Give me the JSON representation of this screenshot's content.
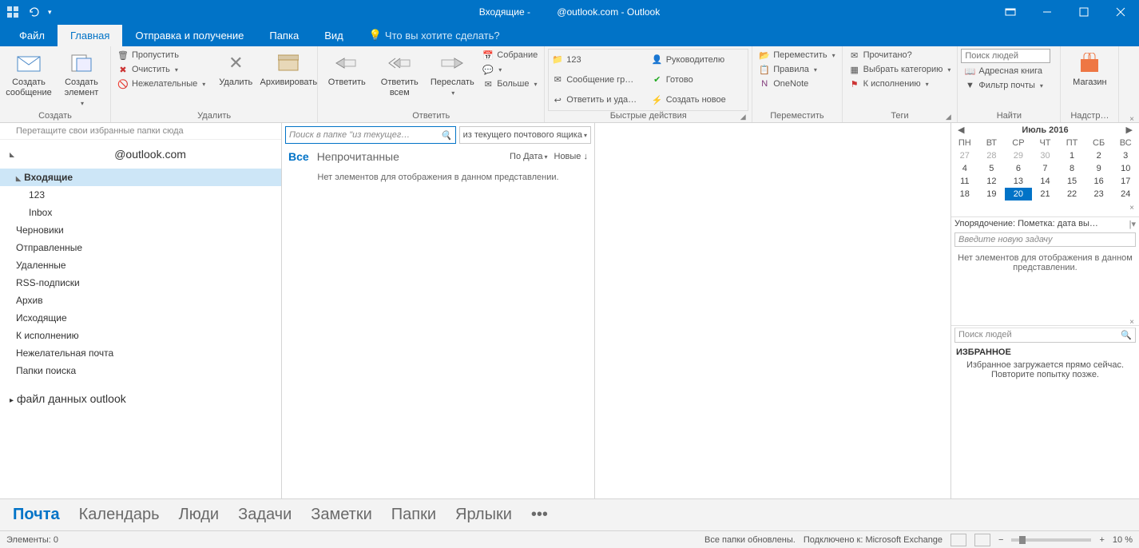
{
  "titlebar": {
    "title_left": "Входящие -",
    "title_right": "@outlook.com - Outlook"
  },
  "tabs": {
    "file": "Файл",
    "home": "Главная",
    "sendreceive": "Отправка и получение",
    "folder": "Папка",
    "view": "Вид",
    "tellme": "Что вы хотите сделать?"
  },
  "ribbon": {
    "new": {
      "msg": "Создать сообщение",
      "item": "Создать элемент",
      "label": "Создать"
    },
    "delete": {
      "ignore": "Пропустить",
      "clean": "Очистить",
      "junk": "Нежелательные",
      "delete": "Удалить",
      "archive": "Архивировать",
      "label": "Удалить"
    },
    "respond": {
      "reply": "Ответить",
      "replyall": "Ответить всем",
      "forward": "Переслать",
      "meeting": "Собрание",
      "more": "Больше",
      "label": "Ответить"
    },
    "quick": {
      "c1": "123",
      "c2": "Сообщение гр…",
      "c3": "Ответить и уда…",
      "c4": "Руководителю",
      "c5": "Готово",
      "c6": "Создать новое",
      "label": "Быстрые действия"
    },
    "move": {
      "move": "Переместить",
      "rules": "Правила",
      "onenote": "OneNote",
      "label": "Переместить"
    },
    "tags": {
      "unread": "Прочитано?",
      "categorize": "Выбрать категорию",
      "followup": "К исполнению",
      "label": "Теги"
    },
    "find": {
      "search_ph": "Поиск людей",
      "addrbook": "Адресная книга",
      "filter": "Фильтр почты",
      "label": "Найти"
    },
    "store": {
      "label_btn": "Магазин",
      "label": "Надстр…"
    }
  },
  "folders": {
    "hint": "Перетащите свои избранные папки сюда",
    "account": "@outlook.com",
    "items": [
      {
        "name": "Входящие",
        "sel": true,
        "exp": true
      },
      {
        "name": "123",
        "sub": true
      },
      {
        "name": "Inbox",
        "sub": true
      },
      {
        "name": "Черновики"
      },
      {
        "name": "Отправленные"
      },
      {
        "name": "Удаленные"
      },
      {
        "name": "RSS-подписки"
      },
      {
        "name": "Архив"
      },
      {
        "name": "Исходящие"
      },
      {
        "name": "К исполнению"
      },
      {
        "name": "Нежелательная почта"
      },
      {
        "name": "Папки поиска"
      }
    ],
    "datafile": "файл данных outlook"
  },
  "msglist": {
    "search_ph": "Поиск в папке \"из текущег…",
    "scope": "из текущего почтового ящика",
    "filter_all": "Все",
    "filter_unread": "Непрочитанные",
    "sort_by": "По Дата",
    "sort_dir": "Новые ↓",
    "empty": "Нет элементов для отображения в данном представлении."
  },
  "todo": {
    "month": "Июль 2016",
    "dow": [
      "ПН",
      "ВТ",
      "СР",
      "ЧТ",
      "ПТ",
      "СБ",
      "ВС"
    ],
    "weeks": [
      [
        "27",
        "28",
        "29",
        "30",
        "1",
        "2",
        "3"
      ],
      [
        "4",
        "5",
        "6",
        "7",
        "8",
        "9",
        "10"
      ],
      [
        "11",
        "12",
        "13",
        "14",
        "15",
        "16",
        "17"
      ],
      [
        "18",
        "19",
        "20",
        "21",
        "22",
        "23",
        "24"
      ]
    ],
    "today": "20",
    "task_sort": "Упорядочение: Пометка: дата вы…",
    "task_ph": "Введите новую задачу",
    "no_items": "Нет элементов для отображения в данном представлении.",
    "ppl_ph": "Поиск людей",
    "fav_head": "ИЗБРАННОЕ",
    "fav_msg": "Избранное загружается прямо сейчас. Повторите попытку позже."
  },
  "nav": [
    "Почта",
    "Календарь",
    "Люди",
    "Задачи",
    "Заметки",
    "Папки",
    "Ярлыки"
  ],
  "status": {
    "items": "Элементы: 0",
    "sync": "Все папки обновлены.",
    "conn": "Подключено к: Microsoft Exchange",
    "zoom": "10 %"
  }
}
